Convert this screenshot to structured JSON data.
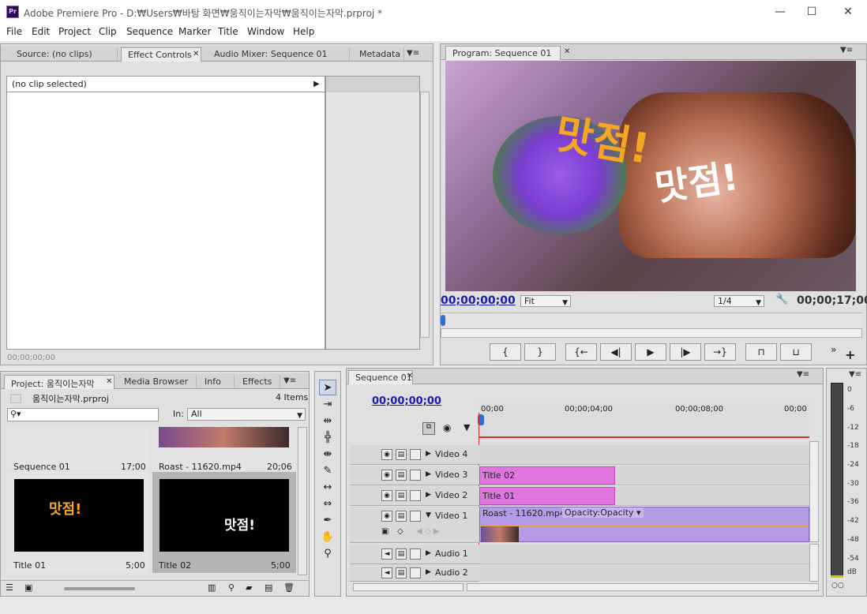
{
  "window": {
    "logo_text": "Pr",
    "title": "Adobe Premiere Pro - D:₩Users₩바탕 화면₩움직이는자막₩움직이는자막.prproj *",
    "min": "—",
    "max": "☐",
    "close": "✕"
  },
  "menu": [
    "File",
    "Edit",
    "Project",
    "Clip",
    "Sequence",
    "Marker",
    "Title",
    "Window",
    "Help"
  ],
  "top_left_tabs": [
    "Source: (no clips)",
    "Effect Controls",
    "Audio Mixer: Sequence 01",
    "Metadata"
  ],
  "effect_controls": {
    "no_clip": "(no clip selected)",
    "timecode": "00;00;00;00"
  },
  "program": {
    "tab": "Program: Sequence 01",
    "overlay_yellow": "맛점!",
    "overlay_white": "맛점!",
    "timecode_left": "00;00;00;00",
    "fit": "Fit",
    "resolution": "1/4",
    "timecode_right": "00;00;17;00",
    "controls": [
      "{",
      "}",
      "{←",
      "◀|",
      "▶",
      "|▶",
      "→}"
    ]
  },
  "project": {
    "tabs": [
      "Project: 움직이는자막",
      "Media Browser",
      "Info",
      "Effects"
    ],
    "file": "움직이는자막.prproj",
    "items_count": "4 Items",
    "in_label": "In:",
    "in_value": "All",
    "items": [
      {
        "name": "Sequence 01",
        "duration": "17;00"
      },
      {
        "name": "Roast - 11620.mp4",
        "duration": "20;06"
      },
      {
        "name": "Title 01",
        "duration": "5;00",
        "thumb_text": "맛점!"
      },
      {
        "name": "Title 02",
        "duration": "5;00",
        "thumb_text": "맛점!"
      }
    ]
  },
  "timeline": {
    "tab": "Sequence 01",
    "timecode": "00;00;00;00",
    "ruler": [
      "00;00",
      "00;00;04;00",
      "00;00;08;00",
      "00;00"
    ],
    "tracks": [
      {
        "name": "Video 4"
      },
      {
        "name": "Video 3",
        "clip": "Title 02"
      },
      {
        "name": "Video 2",
        "clip": "Title 01"
      },
      {
        "name": "Video 1",
        "clip": "Roast - 11620.mp4",
        "fx": "Opacity:Opacity"
      },
      {
        "name": "Audio 1"
      },
      {
        "name": "Audio 2"
      }
    ]
  },
  "meter": {
    "labels": [
      "0",
      "-6",
      "-12",
      "-18",
      "-24",
      "-30",
      "-36",
      "-42",
      "-48",
      "-54",
      "dB"
    ]
  },
  "colors": {
    "accent": "#1b1bb0",
    "title_clip": "#e075e0",
    "video_clip": "#b59ae6",
    "playhead": "#d03030"
  }
}
